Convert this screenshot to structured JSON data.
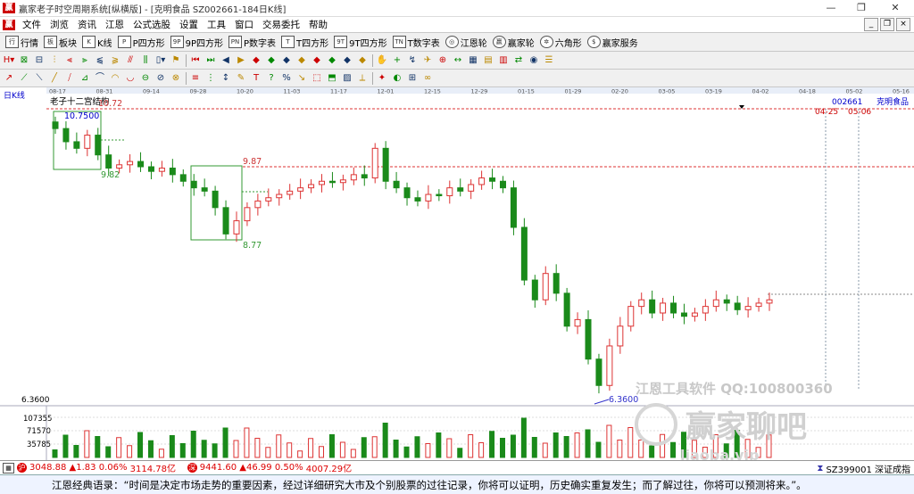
{
  "window": {
    "title": "赢家老子时空周期系统[纵横版] - [克明食品  SZ002661-184日K线]",
    "controls": [
      "—",
      "❐",
      "✕"
    ]
  },
  "menu": [
    "文件",
    "浏览",
    "资讯",
    "江恩",
    "公式选股",
    "设置",
    "工具",
    "窗口",
    "交易委托",
    "帮助"
  ],
  "mdi_controls": [
    "_",
    "❐",
    "×"
  ],
  "toolbar1": [
    {
      "icon": "行",
      "label": "行情"
    },
    {
      "icon": "板",
      "label": "板块"
    },
    {
      "icon": "K",
      "label": "K线"
    },
    {
      "icon": "P",
      "label": "P四方形"
    },
    {
      "icon": "9P",
      "label": "9P四方形"
    },
    {
      "icon": "PN",
      "label": "P数字表"
    },
    {
      "icon": "T",
      "label": "T四方形"
    },
    {
      "icon": "9T",
      "label": "9T四方形"
    },
    {
      "icon": "TN",
      "label": "T数字表"
    },
    {
      "icon": "◎",
      "label": "江恩轮"
    },
    {
      "icon": "赢",
      "label": "赢家轮"
    },
    {
      "icon": "✲",
      "label": "六角形"
    },
    {
      "icon": "$",
      "label": "赢家服务"
    }
  ],
  "toolbar2_icons": [
    "H▾",
    "⊠",
    "⊟",
    "⫶",
    "⫷",
    "⫸",
    "⫹",
    "⫺",
    "⫻",
    "⫼",
    "▯▾",
    "⚑",
    "⏮",
    "⏭",
    "◀",
    "▶",
    "◆",
    "◆",
    "◆",
    "◆",
    "◆",
    "◆",
    "◆",
    "◆",
    "✋",
    "+",
    "↯",
    "✈",
    "⊕",
    "↔",
    "▦",
    "▤",
    "▥",
    "⇄",
    "◉",
    "☰"
  ],
  "toolbar3_icons": [
    "↗",
    "⟋",
    "⟍",
    "╱",
    "⧸",
    "⊿",
    "⌒",
    "◠",
    "◡",
    "⊖",
    "⊘",
    "⊗",
    "≡",
    "⋮",
    "↕",
    "✎",
    "T",
    "?",
    "%",
    "↘",
    "⬚",
    "⬒",
    "▨",
    "⟂",
    "✦",
    "◐",
    "⊞",
    "∞"
  ],
  "chart": {
    "period_label": "日K线",
    "indicator_name": "老子十二宫结构",
    "stock_code": "002661",
    "stock_name": "克明食品",
    "date_ticks": [
      "08-17",
      "08-31",
      "09-14",
      "09-28",
      "10-20",
      "11-03",
      "11-17",
      "12-01",
      "12-15",
      "12-29",
      "01-15",
      "01-29",
      "02-20",
      "03-05",
      "03-19",
      "04-02",
      "04-18",
      "05-02",
      "05-16"
    ],
    "future_date_labels": [
      "04-25",
      "05-06"
    ],
    "price_labels": {
      "top": "10.72",
      "box1_high": "10.7500",
      "box1_low": "9.82",
      "mid": "9.87",
      "box2_low": "8.77",
      "bottom": "6.3600"
    },
    "price_axis_label": "6.3600",
    "volume_axis_labels": [
      "107355",
      "71570",
      "35785"
    ],
    "watermark_line1": "江恩工具软件  QQ:100800360",
    "watermark_line2": "赢家聊吧",
    "watermark_line3": "liaoba.vip"
  },
  "chart_data": {
    "type": "candlestick",
    "title": "老子十二宫结构",
    "symbol": "002661 克明食品",
    "x_ticks": [
      "08-17",
      "08-31",
      "09-14",
      "09-28",
      "10-20",
      "11-03",
      "11-17",
      "12-01",
      "12-15",
      "12-29",
      "01-15",
      "01-29",
      "02-20",
      "03-05",
      "03-19",
      "04-02"
    ],
    "horizontal_levels": [
      10.72,
      9.87,
      6.36
    ],
    "annotated_prices": [
      10.75,
      9.82,
      9.87,
      8.77,
      6.36
    ],
    "close_path": [
      10.5,
      10.3,
      10.2,
      10.4,
      10.1,
      9.9,
      9.95,
      10.0,
      9.92,
      9.85,
      9.9,
      9.8,
      9.7,
      9.6,
      9.55,
      9.3,
      8.9,
      9.1,
      9.3,
      9.4,
      9.45,
      9.5,
      9.55,
      9.6,
      9.65,
      9.7,
      9.68,
      9.72,
      9.8,
      9.75,
      10.2,
      9.7,
      9.6,
      9.45,
      9.4,
      9.5,
      9.48,
      9.6,
      9.55,
      9.65,
      9.75,
      9.7,
      9.6,
      9.0,
      8.2,
      7.9,
      8.3,
      8.0,
      7.5,
      7.6,
      7.0,
      6.6,
      7.2,
      7.5,
      7.8,
      7.9,
      7.7,
      7.85,
      7.7,
      7.65,
      7.7,
      7.8,
      7.9,
      7.85,
      7.75,
      7.8,
      7.85,
      7.9
    ],
    "volume_max": 107355
  },
  "status": {
    "sh_index": "3048.88",
    "sh_change": "▲1.83",
    "sh_pct": "0.06%",
    "sh_amount": "3114.78亿",
    "sz_index": "9441.60",
    "sz_change": "▲46.99",
    "sz_pct": "0.50%",
    "sz_amount": "4007.29亿",
    "right_code": "SZ399001 深证成指"
  },
  "quote": "江恩经典语录：“时间是决定市场走势的重要因素，经过详细研究大市及个别股票的过往记录，你将可以证明，历史确实重复发生；而了解过往，你将可以预测将来。”。"
}
